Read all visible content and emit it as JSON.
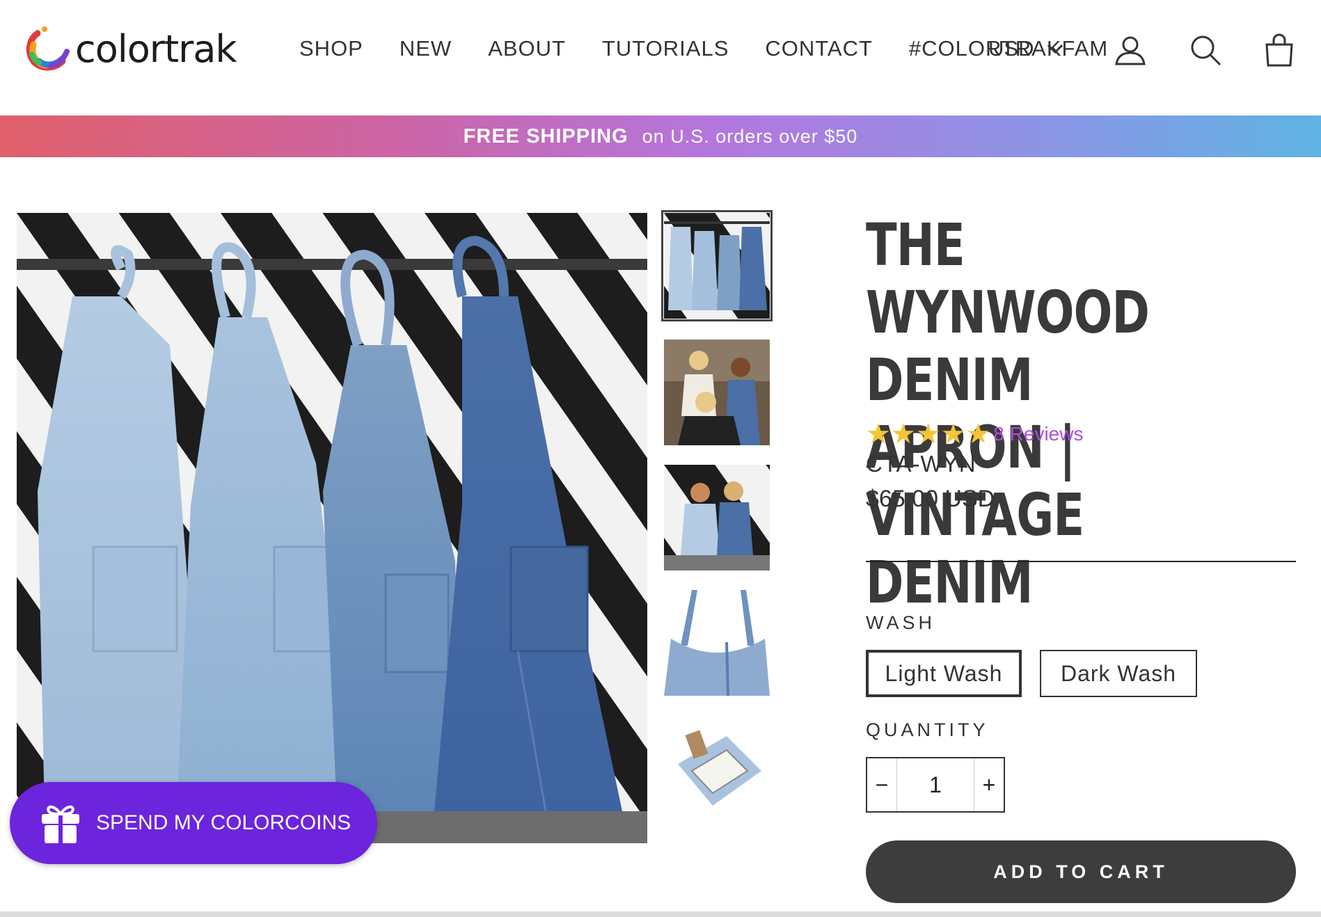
{
  "header": {
    "logo_text": "colortrak",
    "nav": [
      "SHOP",
      "NEW",
      "ABOUT",
      "TUTORIALS",
      "CONTACT",
      "#COLORTRAKFAM"
    ],
    "currency": "USD",
    "icons": [
      "account-icon",
      "search-icon",
      "cart-icon"
    ]
  },
  "banner": {
    "strong": "FREE SHIPPING",
    "text": "on U.S. orders over $50"
  },
  "product": {
    "title": "THE WYNWOOD DENIM APRON | VINTAGE DENIM",
    "rating": 5,
    "rating_max": 5,
    "reviews": "8 Reviews",
    "sku": "CTA-WYN",
    "price": "$65.00 USD",
    "wash_label": "WASH",
    "wash_options": [
      "Light Wash",
      "Dark Wash"
    ],
    "wash_selected": "Light Wash",
    "quantity_label": "QUANTITY",
    "quantity": "1",
    "qty_minus": "−",
    "qty_plus": "+",
    "add_to_cart": "ADD TO CART"
  },
  "gallery": {
    "thumbnails": 5,
    "selected": 1
  },
  "rewards": {
    "label": "SPEND MY COLORCOINS"
  },
  "colors": {
    "accent_purple": "#6c24dc",
    "review_link": "#b24ce0",
    "star": "#f4c533",
    "button_dark": "#3d3d3d"
  }
}
